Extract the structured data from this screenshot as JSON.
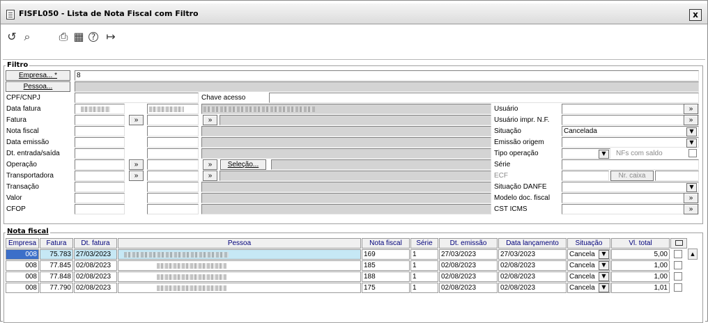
{
  "window": {
    "title": "FISFL050 - Lista de Nota Fiscal com Filtro",
    "close_label": "x"
  },
  "toolbar": {
    "icons": [
      "undo-icon",
      "search-icon",
      "print-icon",
      "calendar-icon",
      "help-icon",
      "exit-icon"
    ],
    "glyphs": {
      "undo": "↺",
      "search": "⌕",
      "print": "⎙",
      "calendar": "▦",
      "help": "?",
      "exit": "↦"
    }
  },
  "filtro": {
    "legend": "Filtro",
    "empresa_button": "Empresa... *",
    "empresa_value": "8",
    "pessoa_button": "Pessoa...",
    "labels": {
      "cpf_cnpj": "CPF/CNPJ",
      "data_fatura": "Data fatura",
      "fatura": "Fatura",
      "nota_fiscal": "Nota fiscal",
      "data_emissao": "Data emissão",
      "dt_entrada_saida": "Dt. entrada/saída",
      "operacao": "Operação",
      "transportadora": "Transportadora",
      "transacao": "Transação",
      "valor": "Valor",
      "cfop": "CFOP",
      "chave_acesso": "Chave acesso",
      "usuario": "Usuário",
      "usuario_impr": "Usuário impr. N.F.",
      "situacao": "Situação",
      "emissao_origem": "Emissão origem",
      "tipo_operacao": "Tipo operação",
      "serie": "Série",
      "ecf": "ECF",
      "situacao_danfe": "Situação DANFE",
      "modelo_doc": "Modelo doc. fiscal",
      "cst_icms": "CST ICMS"
    },
    "situacao_value": "Cancelada",
    "nfs_com_saldo": "NFs com saldo",
    "nr_caixa": "Nr. caixa",
    "selecao_button": "Seleção...",
    "arrow": "»"
  },
  "nota_fiscal": {
    "legend": "Nota fiscal",
    "columns": [
      "Empresa",
      "Fatura",
      "Dt. fatura",
      "Pessoa",
      "Nota fiscal",
      "Série",
      "Dt. emissão",
      "Data lançamento",
      "Situação",
      "Vl. total"
    ],
    "rows": [
      {
        "empresa": "008",
        "fatura": "75.783",
        "dt_fatura": "27/03/2023",
        "nota_fiscal": "169",
        "serie": "1",
        "dt_emissao": "27/03/2023",
        "data_lancamento": "27/03/2023",
        "situacao": "Cancela",
        "vl_total": "5,00"
      },
      {
        "empresa": "008",
        "fatura": "77.845",
        "dt_fatura": "02/08/2023",
        "nota_fiscal": "185",
        "serie": "1",
        "dt_emissao": "02/08/2023",
        "data_lancamento": "02/08/2023",
        "situacao": "Cancela",
        "vl_total": "1,00"
      },
      {
        "empresa": "008",
        "fatura": "77.848",
        "dt_fatura": "02/08/2023",
        "nota_fiscal": "188",
        "serie": "1",
        "dt_emissao": "02/08/2023",
        "data_lancamento": "02/08/2023",
        "situacao": "Cancela",
        "vl_total": "1,00"
      },
      {
        "empresa": "008",
        "fatura": "77.790",
        "dt_fatura": "02/08/2023",
        "nota_fiscal": "175",
        "serie": "1",
        "dt_emissao": "02/08/2023",
        "data_lancamento": "02/08/2023",
        "situacao": "Cancela",
        "vl_total": "1,01"
      }
    ]
  }
}
